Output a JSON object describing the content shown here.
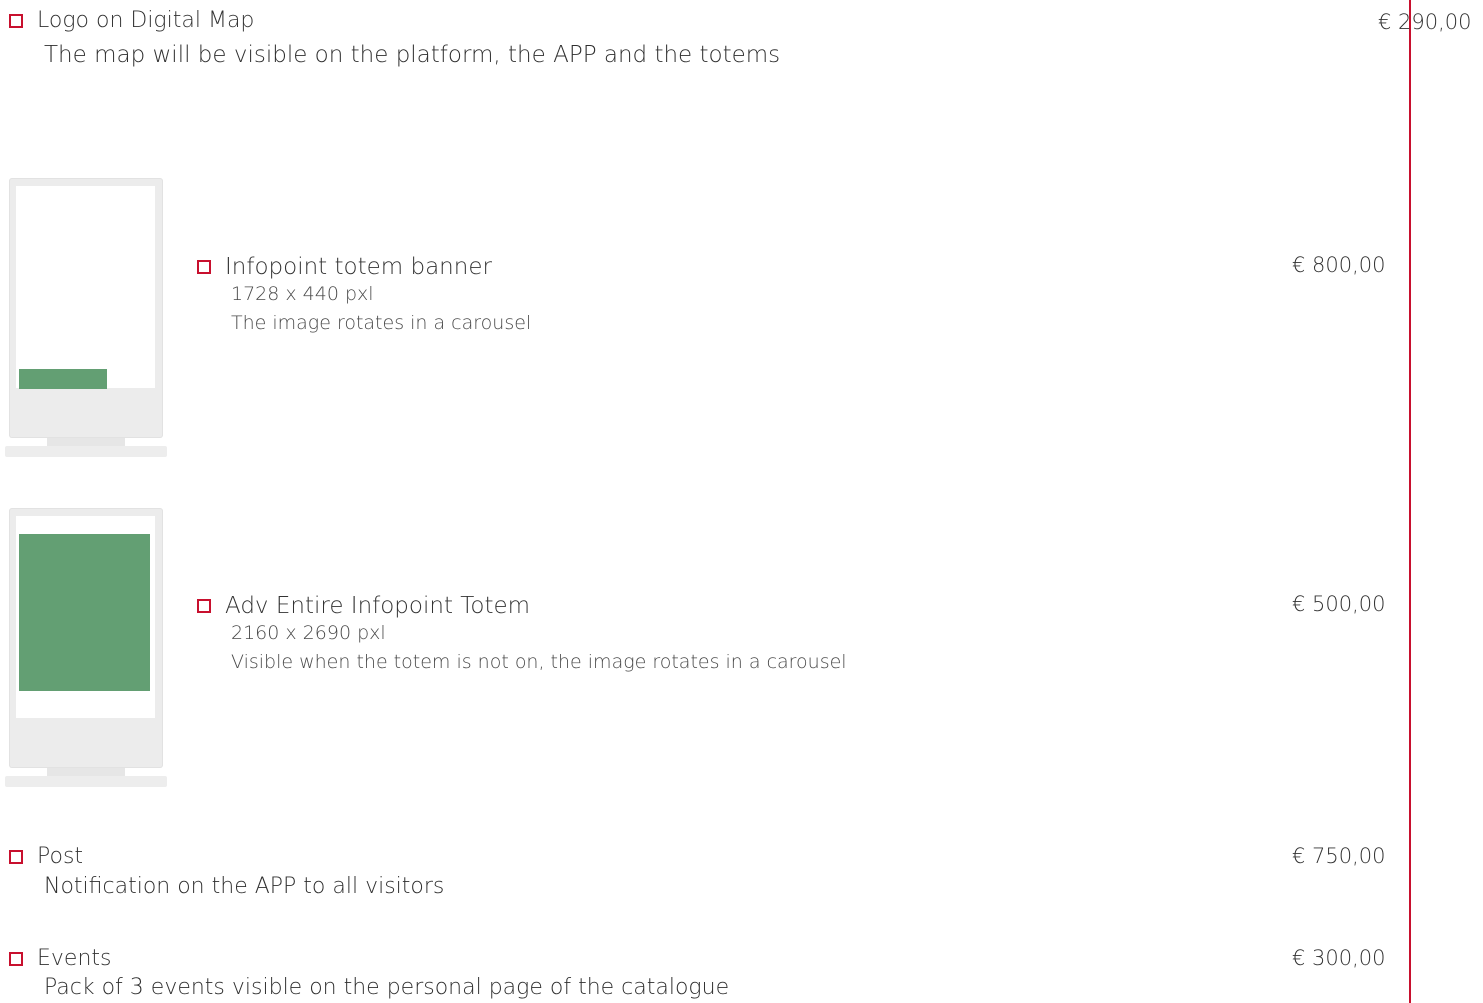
{
  "items": [
    {
      "title": "Logo on Digital Map",
      "description": "The map will be visible on the platform, the APP and the totems",
      "price": "€ 290,00"
    },
    {
      "title": "Infopoint totem banner",
      "size": "1728 x 440 pxl",
      "description": "The image rotates in a carousel",
      "price": "€ 800,00"
    },
    {
      "title": "Adv Entire Infopoint Totem",
      "size": "2160 x 2690 pxl",
      "description": "Visible when the totem is not on, the image rotates in a carousel",
      "price": "€ 500,00"
    },
    {
      "title": "Post",
      "description": "Notification on the APP to all visitors",
      "price": "€ 750,00"
    },
    {
      "title": "Events",
      "description": "Pack of 3 events visible on the personal page of the catalogue",
      "price": "€ 300,00"
    }
  ],
  "colors": {
    "accent": "#c8102e",
    "highlight": "#639f73",
    "totem": "#ececec"
  }
}
